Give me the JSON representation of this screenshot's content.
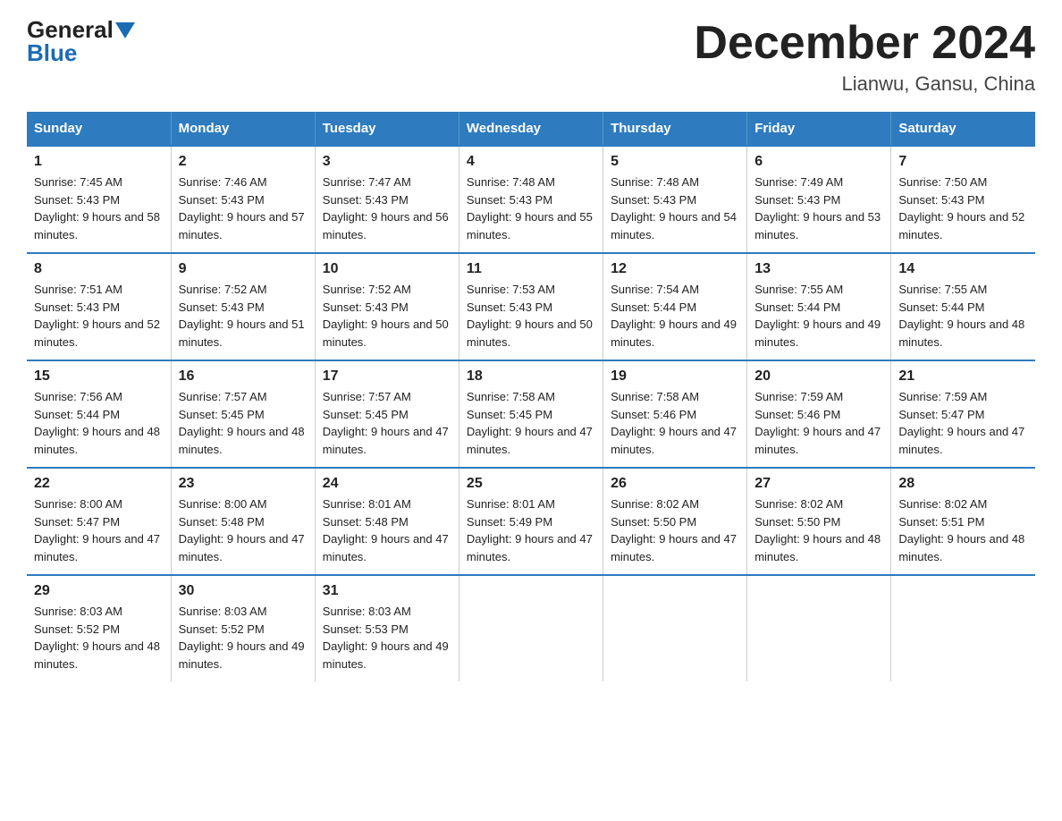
{
  "logo": {
    "general": "General",
    "blue": "Blue"
  },
  "title": "December 2024",
  "subtitle": "Lianwu, Gansu, China",
  "headers": [
    "Sunday",
    "Monday",
    "Tuesday",
    "Wednesday",
    "Thursday",
    "Friday",
    "Saturday"
  ],
  "weeks": [
    [
      {
        "day": "1",
        "sunrise": "7:45 AM",
        "sunset": "5:43 PM",
        "daylight": "9 hours and 58 minutes."
      },
      {
        "day": "2",
        "sunrise": "7:46 AM",
        "sunset": "5:43 PM",
        "daylight": "9 hours and 57 minutes."
      },
      {
        "day": "3",
        "sunrise": "7:47 AM",
        "sunset": "5:43 PM",
        "daylight": "9 hours and 56 minutes."
      },
      {
        "day": "4",
        "sunrise": "7:48 AM",
        "sunset": "5:43 PM",
        "daylight": "9 hours and 55 minutes."
      },
      {
        "day": "5",
        "sunrise": "7:48 AM",
        "sunset": "5:43 PM",
        "daylight": "9 hours and 54 minutes."
      },
      {
        "day": "6",
        "sunrise": "7:49 AM",
        "sunset": "5:43 PM",
        "daylight": "9 hours and 53 minutes."
      },
      {
        "day": "7",
        "sunrise": "7:50 AM",
        "sunset": "5:43 PM",
        "daylight": "9 hours and 52 minutes."
      }
    ],
    [
      {
        "day": "8",
        "sunrise": "7:51 AM",
        "sunset": "5:43 PM",
        "daylight": "9 hours and 52 minutes."
      },
      {
        "day": "9",
        "sunrise": "7:52 AM",
        "sunset": "5:43 PM",
        "daylight": "9 hours and 51 minutes."
      },
      {
        "day": "10",
        "sunrise": "7:52 AM",
        "sunset": "5:43 PM",
        "daylight": "9 hours and 50 minutes."
      },
      {
        "day": "11",
        "sunrise": "7:53 AM",
        "sunset": "5:43 PM",
        "daylight": "9 hours and 50 minutes."
      },
      {
        "day": "12",
        "sunrise": "7:54 AM",
        "sunset": "5:44 PM",
        "daylight": "9 hours and 49 minutes."
      },
      {
        "day": "13",
        "sunrise": "7:55 AM",
        "sunset": "5:44 PM",
        "daylight": "9 hours and 49 minutes."
      },
      {
        "day": "14",
        "sunrise": "7:55 AM",
        "sunset": "5:44 PM",
        "daylight": "9 hours and 48 minutes."
      }
    ],
    [
      {
        "day": "15",
        "sunrise": "7:56 AM",
        "sunset": "5:44 PM",
        "daylight": "9 hours and 48 minutes."
      },
      {
        "day": "16",
        "sunrise": "7:57 AM",
        "sunset": "5:45 PM",
        "daylight": "9 hours and 48 minutes."
      },
      {
        "day": "17",
        "sunrise": "7:57 AM",
        "sunset": "5:45 PM",
        "daylight": "9 hours and 47 minutes."
      },
      {
        "day": "18",
        "sunrise": "7:58 AM",
        "sunset": "5:45 PM",
        "daylight": "9 hours and 47 minutes."
      },
      {
        "day": "19",
        "sunrise": "7:58 AM",
        "sunset": "5:46 PM",
        "daylight": "9 hours and 47 minutes."
      },
      {
        "day": "20",
        "sunrise": "7:59 AM",
        "sunset": "5:46 PM",
        "daylight": "9 hours and 47 minutes."
      },
      {
        "day": "21",
        "sunrise": "7:59 AM",
        "sunset": "5:47 PM",
        "daylight": "9 hours and 47 minutes."
      }
    ],
    [
      {
        "day": "22",
        "sunrise": "8:00 AM",
        "sunset": "5:47 PM",
        "daylight": "9 hours and 47 minutes."
      },
      {
        "day": "23",
        "sunrise": "8:00 AM",
        "sunset": "5:48 PM",
        "daylight": "9 hours and 47 minutes."
      },
      {
        "day": "24",
        "sunrise": "8:01 AM",
        "sunset": "5:48 PM",
        "daylight": "9 hours and 47 minutes."
      },
      {
        "day": "25",
        "sunrise": "8:01 AM",
        "sunset": "5:49 PM",
        "daylight": "9 hours and 47 minutes."
      },
      {
        "day": "26",
        "sunrise": "8:02 AM",
        "sunset": "5:50 PM",
        "daylight": "9 hours and 47 minutes."
      },
      {
        "day": "27",
        "sunrise": "8:02 AM",
        "sunset": "5:50 PM",
        "daylight": "9 hours and 48 minutes."
      },
      {
        "day": "28",
        "sunrise": "8:02 AM",
        "sunset": "5:51 PM",
        "daylight": "9 hours and 48 minutes."
      }
    ],
    [
      {
        "day": "29",
        "sunrise": "8:03 AM",
        "sunset": "5:52 PM",
        "daylight": "9 hours and 48 minutes."
      },
      {
        "day": "30",
        "sunrise": "8:03 AM",
        "sunset": "5:52 PM",
        "daylight": "9 hours and 49 minutes."
      },
      {
        "day": "31",
        "sunrise": "8:03 AM",
        "sunset": "5:53 PM",
        "daylight": "9 hours and 49 minutes."
      },
      null,
      null,
      null,
      null
    ]
  ]
}
